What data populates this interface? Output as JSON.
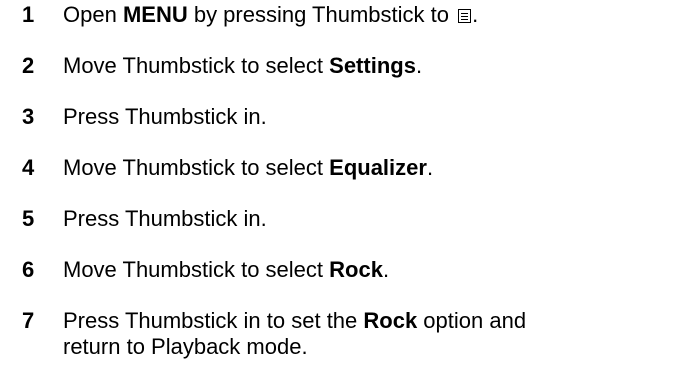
{
  "steps": [
    {
      "number": "1",
      "segments": [
        {
          "text": "Open "
        },
        {
          "text": "MENU",
          "bold": true
        },
        {
          "text": " by pressing Thumbstick to "
        },
        {
          "icon": "menu-icon"
        },
        {
          "text": "."
        }
      ]
    },
    {
      "number": "2",
      "segments": [
        {
          "text": "Move Thumbstick to select "
        },
        {
          "text": "Settings",
          "bold": true
        },
        {
          "text": "."
        }
      ]
    },
    {
      "number": "3",
      "segments": [
        {
          "text": "Press Thumbstick in."
        }
      ]
    },
    {
      "number": "4",
      "segments": [
        {
          "text": "Move Thumbstick to select "
        },
        {
          "text": "Equalizer",
          "bold": true
        },
        {
          "text": "."
        }
      ]
    },
    {
      "number": "5",
      "segments": [
        {
          "text": "Press Thumbstick in."
        }
      ]
    },
    {
      "number": "6",
      "segments": [
        {
          "text": "Move Thumbstick to select "
        },
        {
          "text": "Rock",
          "bold": true
        },
        {
          "text": "."
        }
      ]
    },
    {
      "number": "7",
      "segments": [
        {
          "text": "Press Thumbstick in to set the "
        },
        {
          "text": "Rock",
          "bold": true
        },
        {
          "text": " option and"
        },
        {
          "break": true
        },
        {
          "text": "return to Playback mode."
        }
      ]
    }
  ]
}
